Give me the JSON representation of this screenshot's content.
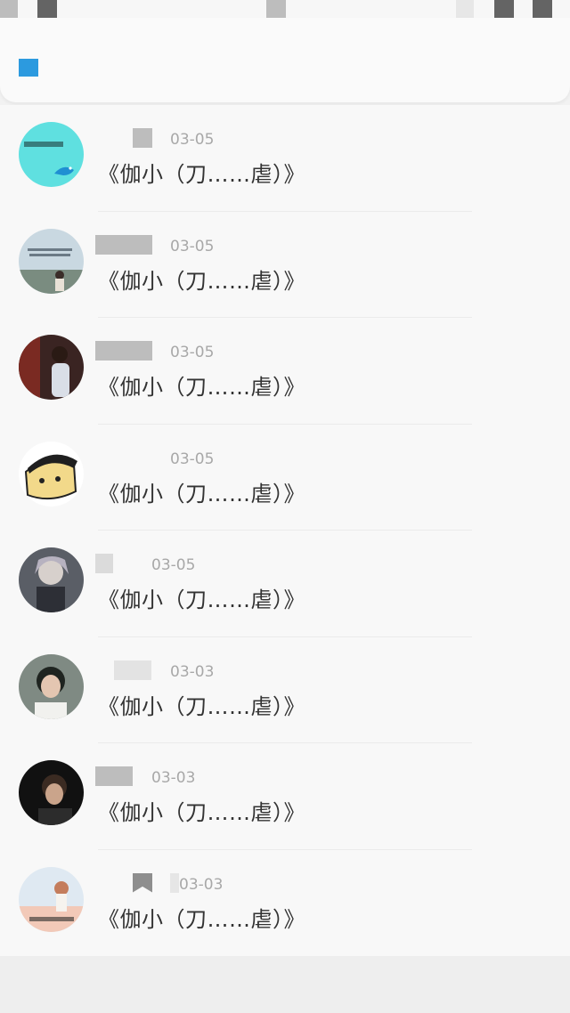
{
  "header": {
    "icon": "square-icon",
    "accent": "#2c9adf"
  },
  "items": [
    {
      "date": "03-05",
      "title": "《伽小（刀……虐）》",
      "avatar": "whale-text-avatar"
    },
    {
      "date": "03-05",
      "title": "《伽小（刀……虐）》",
      "avatar": "seaside-girl-avatar"
    },
    {
      "date": "03-05",
      "title": "《伽小（刀……虐）》",
      "avatar": "woman-photo-avatar"
    },
    {
      "date": "03-05",
      "title": "《伽小（刀……虐）》",
      "avatar": "cartoon-face-avatar"
    },
    {
      "date": "03-05",
      "title": "《伽小（刀……虐）》",
      "avatar": "anime-character-avatar"
    },
    {
      "date": "03-03",
      "title": "《伽小（刀……虐）》",
      "avatar": "young-man-avatar"
    },
    {
      "date": "03-03",
      "title": "《伽小（刀……虐）》",
      "avatar": "dark-portrait-avatar"
    },
    {
      "date": "03-03",
      "title": "《伽小（刀……虐）》",
      "avatar": "girl-flowers-avatar"
    }
  ]
}
